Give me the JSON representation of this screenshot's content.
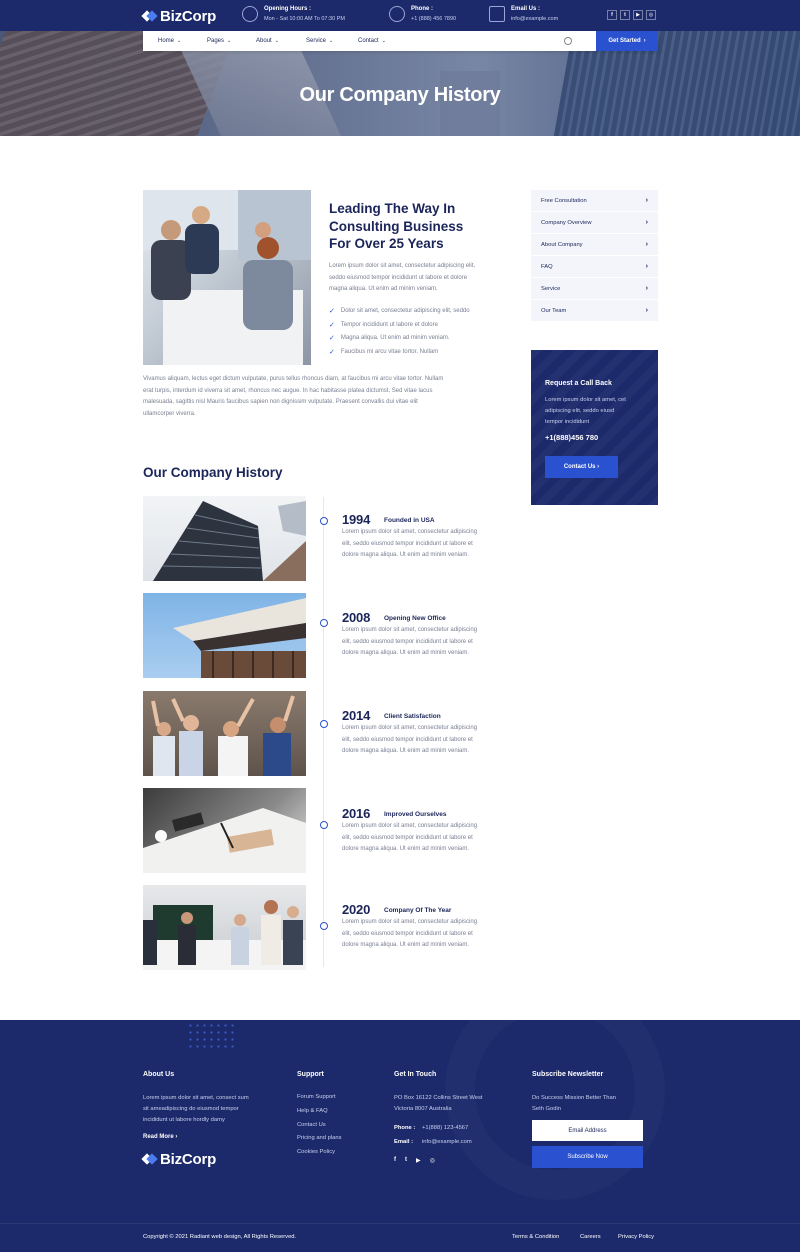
{
  "topbar": {
    "logo_text": "BizCorp",
    "hours_label": "Opening Hours :",
    "hours_value": "Mon - Sat 10:00 AM To 07:30 PM",
    "phone_label": "Phone :",
    "phone_value": "+1 (888) 456 7890",
    "email_label": "Email Us :",
    "email_value": "info@example.com",
    "social": [
      "f",
      "t",
      "yt",
      "ig"
    ]
  },
  "nav": {
    "items": [
      "Home",
      "Pages",
      "About",
      "Service",
      "Contact"
    ],
    "cta": "Get Started"
  },
  "hero": {
    "title": "Our Company History"
  },
  "intro": {
    "heading_l1": "Leading The Way In",
    "heading_l2": "Consulting Business",
    "heading_l3": "For Over 25 Years",
    "para_l1": "Lorem ipsum dolor sit amet, consectetur adipiscing elit,",
    "para_l2": "seddo eiusmod tempor incididunt ut labore et dolore",
    "para_l3": "magna aliqua. Ut enim ad minim veniam.",
    "checks": [
      "Dolor sit amet, consectetur adipiscing elit, seddo",
      "Tempor incididunt ut labore et dolore",
      "Magna aliqua. Ut enim ad minim veniam.",
      "Faucibus mi arcu vitae tortor. Nullam"
    ],
    "body_l1": "Vivamus aliquam, lectus eget dictum vulputate, purus tellus rhoncus diam, at faucibus mi arcu vitae tortor. Nullam",
    "body_l2": "erat turpis, interdum id viverra sit amet, rhoncus nec augue. In hac habitasse platea dictumst. Sed vitae lacus",
    "body_l3": "malesuada, sagittis nisl Mauris faucibus sapien non dignissim vulputate. Praesent convallis dui vitae elit",
    "body_l4": "ullamcorper viverra."
  },
  "sidebar": {
    "links": [
      "Free Consultation",
      "Company Overview",
      "About Company",
      "FAQ",
      "Service",
      "Our Team"
    ],
    "call_title": "Request a Call Back",
    "call_l1": "Lorem ipsum dolor sit amet, cet",
    "call_l2": "adipiscing elit, seddo eiusd",
    "call_l3": "tempor incididunt",
    "call_phone": "+1(888)456 780",
    "call_btn": "Contact Us"
  },
  "history": {
    "title": "Our Company History",
    "body_l1": "Lorem ipsum dolor sit amet, consectetur adipiscing",
    "body_l2": "elit, seddo eiusmod tempor incididunt ut labore et",
    "body_l3": "dolore magna aliqua. Ut enim ad minim veniam.",
    "events": [
      {
        "year": "1994",
        "label": "Founded in USA"
      },
      {
        "year": "2008",
        "label": "Opening New Office"
      },
      {
        "year": "2014",
        "label": "Client Satisfaction"
      },
      {
        "year": "2016",
        "label": "Improved Ourselves"
      },
      {
        "year": "2020",
        "label": "Company Of The Year"
      }
    ]
  },
  "footer": {
    "about_title": "About Us",
    "about_l1": "Lorem ipsum dolor sit amet, consect sum",
    "about_l2": "sit ameadipiscing do eiusmod tempor",
    "about_l3": "incididunt ut labore hordly damy",
    "read_more": "Read More",
    "logo_text": "BizCorp",
    "support_title": "Support",
    "support_links": [
      "Forum Support",
      "Help & FAQ",
      "Contact Us",
      "Pricing and plans",
      "Cookies Policy"
    ],
    "touch_title": "Get In Touch",
    "addr_l1": "PO Box 16122 Collins Street West",
    "addr_l2": "Victoria 8007 Australia",
    "phone_label": "Phone :",
    "phone_value": "+1(888) 123-4567",
    "email_label": "Email :",
    "email_value": "info@example.com",
    "news_title": "Subscribe Newsletter",
    "news_l1": "Do Success Mission Better Than",
    "news_l2": "Seth Godin",
    "email_placeholder": "Email Address",
    "subscribe": "Subscribe Now",
    "copyright": "Copyright © 2021 Radiant web design, All Rights Reserved.",
    "bottom_links": [
      "Terms & Condition",
      "Careers",
      "Privacy Policy"
    ]
  },
  "colors": {
    "navy": "#1c2a6b",
    "accent": "#2a52d0"
  }
}
